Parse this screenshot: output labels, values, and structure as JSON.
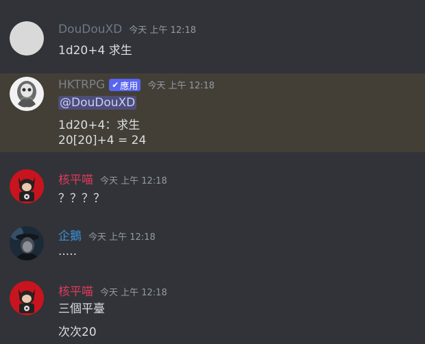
{
  "colors": {
    "background": "#313338",
    "highlight_background": "#433f37",
    "name_grey": "#6d7a85",
    "name_red": "#e03a5b",
    "name_blue": "#3a8fd6",
    "name_bot": "#7c8088",
    "bot_tag": "#5865f2",
    "timestamp": "#949ba4",
    "text": "#dbdee1",
    "mention_bg": "#4e4f79"
  },
  "messages": [
    {
      "username": "DouDouXD",
      "timestamp": "今天 上午 12:18",
      "lines": [
        "1d20+4 求生"
      ]
    },
    {
      "username": "HKTRPG",
      "bot_tag": "應用",
      "timestamp": "今天 上午 12:18",
      "mention": "@DouDouXD",
      "lines": [
        "1d20+4：求生",
        "20[20]+4 = 24"
      ]
    },
    {
      "username": "核平喵",
      "timestamp": "今天 上午 12:18",
      "lines": [
        "？？？？"
      ]
    },
    {
      "username": "企鵝",
      "timestamp": "今天 上午 12:18",
      "lines": [
        "....."
      ]
    },
    {
      "username": "核平喵",
      "timestamp": "今天 上午 12:18",
      "lines": [
        "三個平臺",
        "次次20"
      ]
    }
  ]
}
